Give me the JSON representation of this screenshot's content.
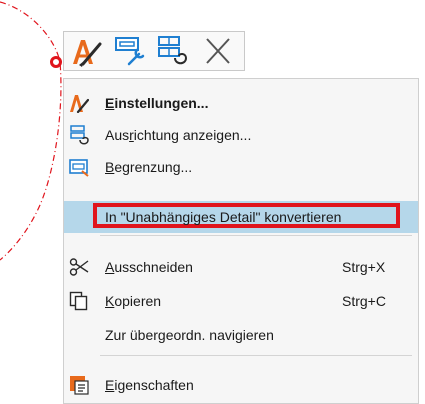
{
  "toolbar": {
    "buttons": [
      {
        "name": "settings-tool-button",
        "icon": "pen-brush-icon"
      },
      {
        "name": "frame-tool-button",
        "icon": "frame-wrench-icon"
      },
      {
        "name": "orientation-tool-button",
        "icon": "orientation-icon"
      },
      {
        "name": "close-tool-button",
        "icon": "close-icon"
      }
    ]
  },
  "menu": {
    "items": [
      {
        "pre": "",
        "mn": "E",
        "post": "instellungen...",
        "shortcut": "",
        "icon": "pen-brush-icon"
      },
      {
        "pre": "Aus",
        "mn": "r",
        "post": "ichtung anzeigen...",
        "shortcut": "",
        "icon": "orientation-icon"
      },
      {
        "pre": "",
        "mn": "B",
        "post": "egrenzung...",
        "shortcut": "",
        "icon": "boundary-icon"
      },
      {
        "pre": "In \"Unabhängiges Detail\" konvertieren",
        "mn": "",
        "post": "",
        "shortcut": "",
        "icon": ""
      },
      {
        "pre": "",
        "mn": "A",
        "post": "usschneiden",
        "shortcut": "Strg+X",
        "icon": "scissors-icon"
      },
      {
        "pre": "",
        "mn": "K",
        "post": "opieren",
        "shortcut": "Strg+C",
        "icon": "copy-icon"
      },
      {
        "pre": "Zur übergeordn. navigieren",
        "mn": "",
        "post": "",
        "shortcut": "",
        "icon": ""
      },
      {
        "pre": "",
        "mn": "E",
        "post": "igenschaften",
        "shortcut": "",
        "icon": "properties-icon"
      }
    ]
  },
  "colors": {
    "highlight": "#b5d7ea",
    "annotation_frame": "#e0141c",
    "curve": "#e0141c",
    "menu_bg": "#f6f6f6"
  }
}
